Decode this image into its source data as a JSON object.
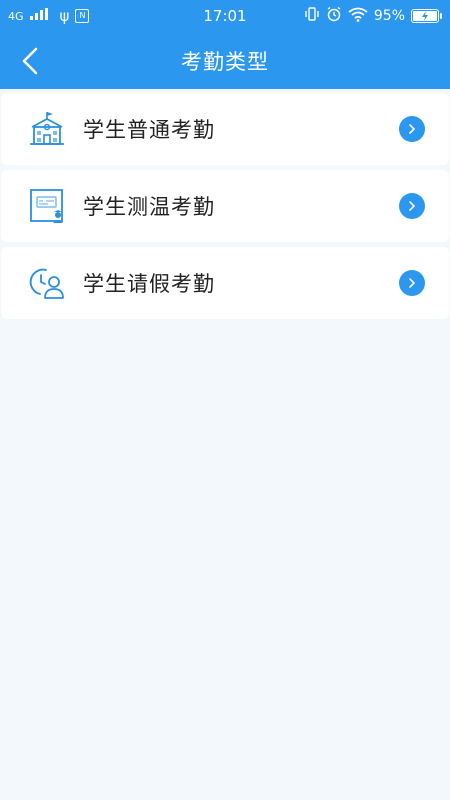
{
  "statusbar": {
    "network": "4G",
    "usb_label": "ψ",
    "app_badge": "N",
    "time": "17:01",
    "battery_pct": "95%",
    "battery_level": 0.95,
    "icons": [
      "signal-icon",
      "usb-icon",
      "vibrate-icon",
      "alarm-icon",
      "wifi-icon",
      "battery-icon"
    ]
  },
  "navbar": {
    "title": "考勤类型",
    "back_icon": "chevron-left-icon"
  },
  "menu": {
    "items": [
      {
        "label": "学生普通考勤",
        "icon": "school-building-icon"
      },
      {
        "label": "学生测温考勤",
        "icon": "temperature-screen-icon"
      },
      {
        "label": "学生请假考勤",
        "icon": "clock-person-icon"
      }
    ],
    "chevron_icon": "chevron-right-circle-icon"
  },
  "colors": {
    "primary": "#2b97ee",
    "background": "#f3f8fc",
    "card": "#ffffff",
    "text": "#222222"
  }
}
